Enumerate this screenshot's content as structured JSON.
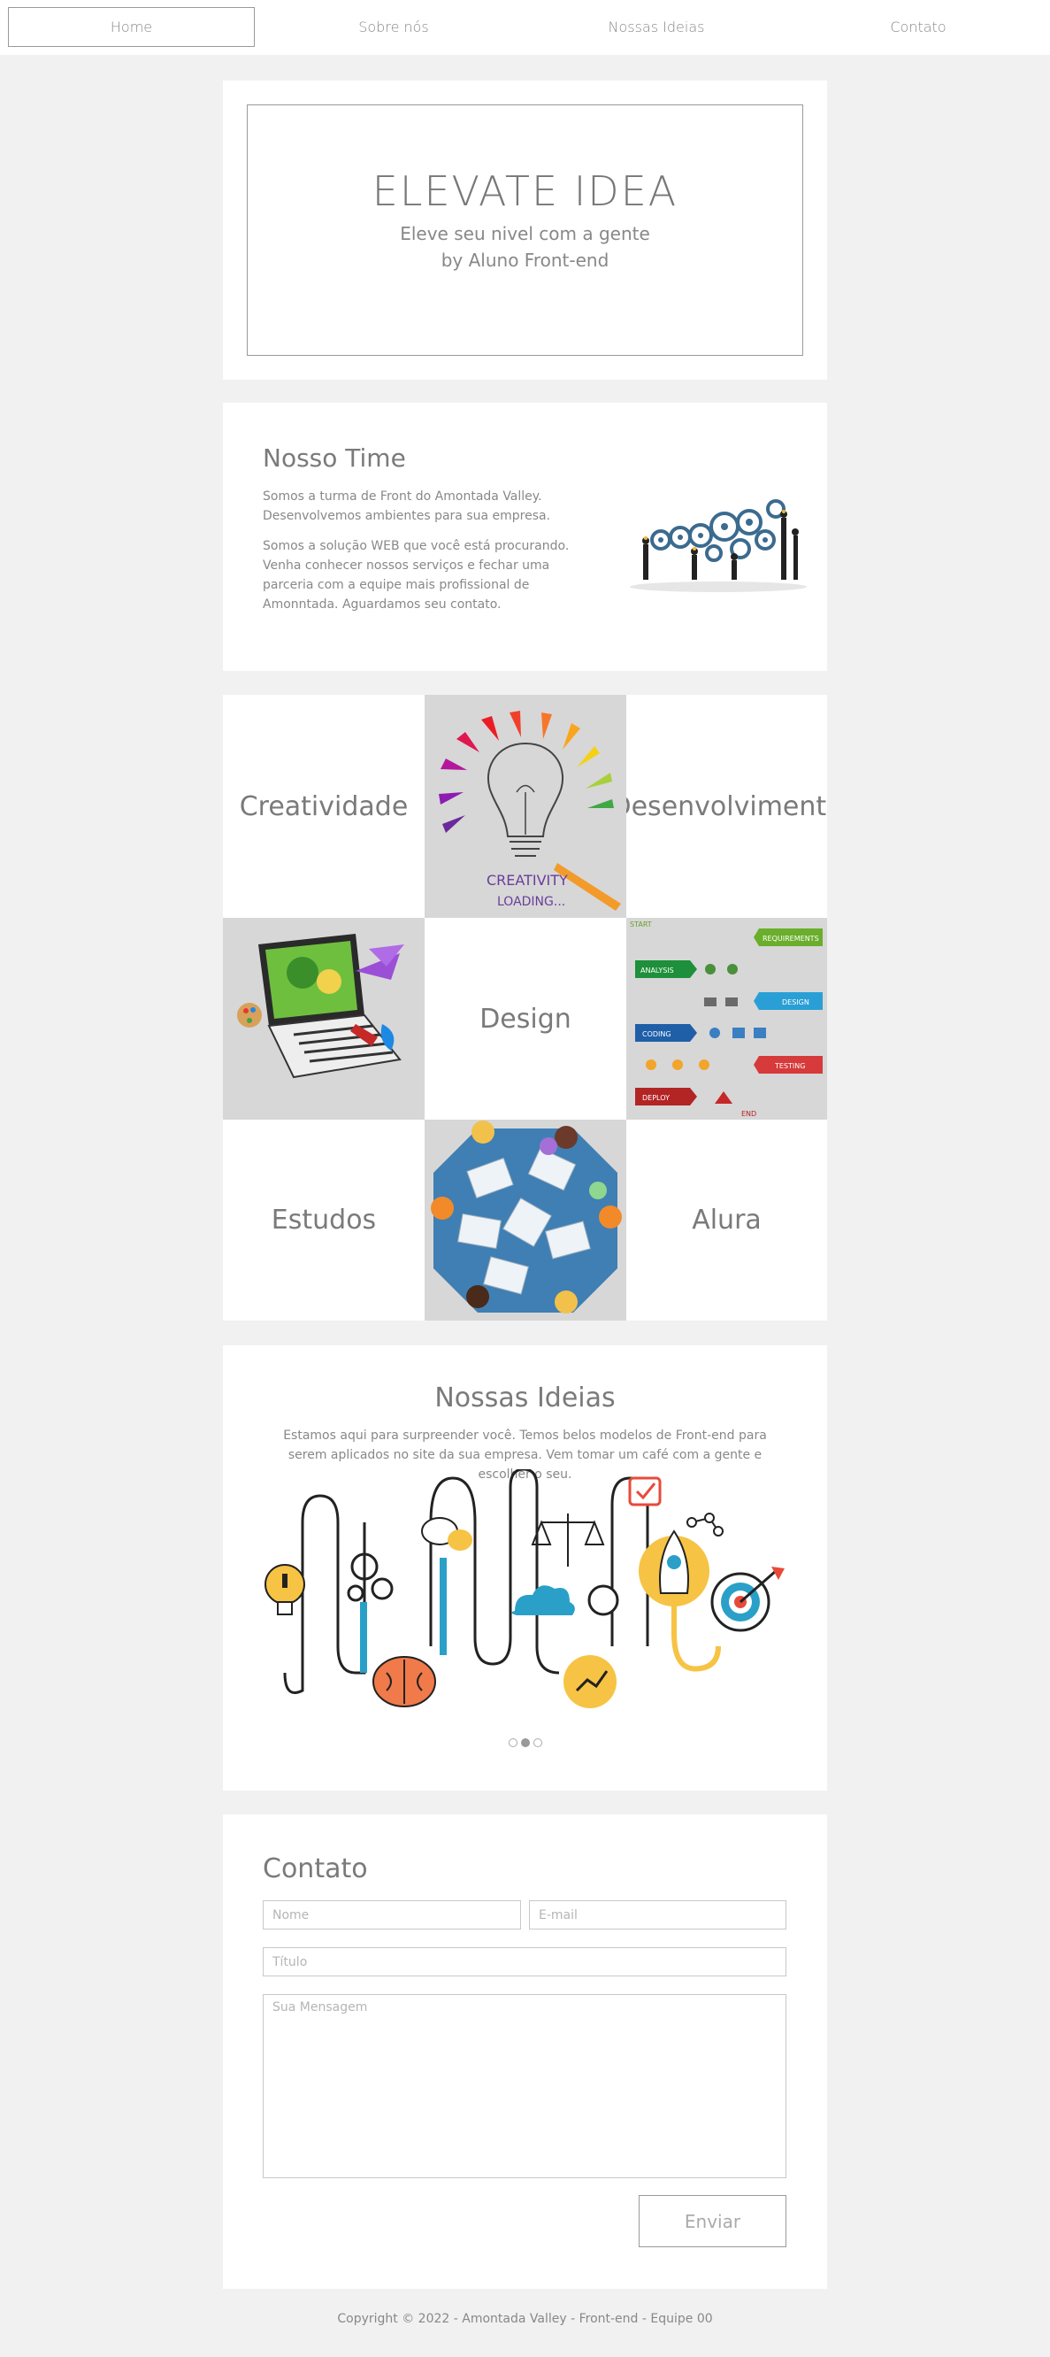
{
  "nav": {
    "items": [
      {
        "label": "Home",
        "active": true
      },
      {
        "label": "Sobre nós",
        "active": false
      },
      {
        "label": "Nossas Ideias",
        "active": false
      },
      {
        "label": "Contato",
        "active": false
      }
    ]
  },
  "hero": {
    "title": "ELEVATE IDEA",
    "subtitle": "Eleve seu nivel com a gente",
    "byline": "by Aluno Front-end"
  },
  "team": {
    "title": "Nosso Time",
    "paragraph1": "Somos a turma de Front do Amontada Valley. Desenvolvemos ambientes para sua empresa.",
    "paragraph2": "Somos a solução WEB que você está procurando. Venha conhecer nossos serviços e fechar uma parceria com a equipe mais profissional de Amonntada. Aguardamos seu contato."
  },
  "grid": {
    "creatividade": "Creatividade",
    "desenvolvimento": "Desenvolvimento",
    "design": "Design",
    "estudos": "Estudos",
    "alura": "Alura",
    "creativity_img": {
      "line1": "CREATIVITY",
      "line2": "LOADING..."
    },
    "process_img": {
      "start": "START",
      "requirements": "REQUIREMENTS",
      "analysis": "ANALYSIS",
      "design": "DESIGN",
      "coding": "CODING",
      "testing": "TESTING",
      "deploy": "DEPLOY",
      "end": "END"
    }
  },
  "ideas": {
    "title": "Nossas Ideias",
    "text": "Estamos aqui para surpreender você. Temos belos modelos de Front-end para serem aplicados no site da sua empresa. Vem tomar um café com a gente e escolher o seu.",
    "carousel": {
      "count": 3,
      "active": 2
    }
  },
  "contact": {
    "title": "Contato",
    "name_placeholder": "Nome",
    "email_placeholder": "E-mail",
    "subject_placeholder": "Título",
    "message_placeholder": "Sua Mensagem",
    "send_label": "Enviar"
  },
  "footer": {
    "text": "Copyright © 2022 - Amontada Valley - Front-end - Equipe 00"
  },
  "colors": {
    "page_bg": "#f1f1f1",
    "card_bg": "#ffffff",
    "text": "#7a7a7a",
    "border": "#9a9a9a"
  }
}
